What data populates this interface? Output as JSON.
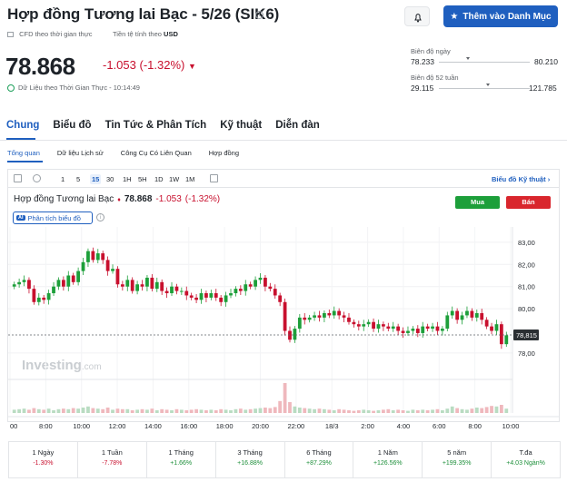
{
  "header": {
    "title": "Hợp đồng Tương lai Bạc - 5/26 (SIK6)",
    "watchlist_label": "Thêm vào Danh Mục",
    "cfd_label": "CFD theo thời gian thực",
    "currency_label": "Tiền tệ tính theo",
    "currency": "USD"
  },
  "quote": {
    "price": "78.868",
    "change": "-1.053",
    "change_pct": "(-1.32%)",
    "realtime_label": "Dữ Liệu theo Thời Gian Thực - 10:14:49"
  },
  "ranges": {
    "day_label": "Biên độ ngày",
    "day_low": "78.233",
    "day_high": "80.210",
    "day_fraction": 0.32,
    "week52_label": "Biên độ 52 tuần",
    "week52_low": "29.115",
    "week52_high": "121.785",
    "week52_fraction": 0.54
  },
  "tabs": [
    "Chung",
    "Biểu đồ",
    "Tin Tức & Phân Tích",
    "Kỹ thuật",
    "Diễn đàn"
  ],
  "subtabs": [
    "Tổng quan",
    "Dữ liệu Lịch sử",
    "Công Cụ Có Liên Quan",
    "Hợp đồng"
  ],
  "toolbar": {
    "timeframes": [
      "1",
      "5",
      "15",
      "30",
      "1H",
      "5H",
      "1D",
      "1W",
      "1M"
    ],
    "active_timeframe": "15",
    "tech_link": "Biểu đồ Kỹ thuật"
  },
  "chart_header": {
    "name": "Hợp đồng Tương lai Bạc",
    "price": "78.868",
    "change": "-1.053",
    "change_pct": "(-1.32%)",
    "buy_label": "Mua",
    "sell_label": "Bán",
    "analyze_label": "Phân tích biểu đồ",
    "ai_label": "AI",
    "watermark": "Investing",
    "watermark_suffix": ".com",
    "last_price_tag": "78,815"
  },
  "chart_data": {
    "type": "candlestick",
    "interval": "15",
    "x_ticks": [
      "00",
      "8:00",
      "10:00",
      "12:00",
      "14:00",
      "16:00",
      "18:00",
      "20:00",
      "22:00",
      "18/3",
      "2:00",
      "4:00",
      "6:00",
      "8:00",
      "10:00"
    ],
    "y_ticks": [
      "83,00",
      "82,00",
      "81,00",
      "80,00",
      "78,00"
    ],
    "ylim": [
      77.3,
      83.2
    ],
    "last_price": 78.815,
    "closes": [
      81.1,
      81.2,
      81.3,
      80.9,
      80.3,
      80.5,
      80.4,
      80.7,
      81.0,
      81.3,
      81.0,
      81.5,
      81.2,
      81.7,
      82.1,
      82.6,
      82.2,
      82.5,
      82.2,
      81.7,
      81.8,
      81.1,
      81.0,
      81.3,
      80.8,
      81.1,
      81.0,
      81.4,
      80.9,
      81.2,
      80.8,
      80.7,
      81.0,
      80.8,
      80.8,
      80.6,
      80.5,
      80.4,
      80.7,
      80.5,
      80.7,
      80.5,
      80.3,
      80.6,
      80.7,
      80.9,
      80.8,
      81.1,
      81.0,
      81.3,
      81.4,
      81.0,
      80.9,
      80.6,
      80.3,
      79.0,
      78.6,
      79.1,
      79.6,
      79.5,
      79.6,
      79.7,
      79.6,
      79.8,
      79.7,
      79.9,
      79.7,
      79.6,
      79.4,
      79.3,
      79.2,
      79.3,
      79.4,
      79.1,
      79.3,
      79.2,
      79.1,
      79.2,
      79.0,
      78.9,
      79.0,
      79.1,
      78.9,
      79.2,
      79.1,
      79.2,
      79.0,
      79.1,
      79.7,
      79.9,
      79.5,
      79.7,
      79.9,
      79.6,
      79.8,
      79.5,
      79.2,
      79.0,
      79.3,
      78.4,
      78.8
    ],
    "volumes": [
      6,
      7,
      8,
      6,
      9,
      7,
      6,
      8,
      5,
      7,
      8,
      7,
      9,
      8,
      10,
      12,
      9,
      8,
      7,
      10,
      6,
      8,
      7,
      7,
      5,
      6,
      7,
      6,
      8,
      5,
      7,
      6,
      5,
      7,
      6,
      5,
      6,
      7,
      6,
      5,
      6,
      5,
      7,
      6,
      5,
      7,
      8,
      6,
      7,
      8,
      9,
      10,
      9,
      11,
      22,
      55,
      20,
      12,
      10,
      9,
      8,
      7,
      8,
      7,
      6,
      5,
      7,
      6,
      5,
      4,
      5,
      6,
      5,
      4,
      5,
      6,
      7,
      5,
      6,
      5,
      4,
      6,
      5,
      6,
      5,
      6,
      7,
      5,
      8,
      12,
      9,
      7,
      6,
      8,
      10,
      9,
      11,
      13,
      12,
      15,
      8
    ]
  },
  "performance": [
    {
      "label": "1 Ngày",
      "value": "-1.30%",
      "trend": "neg"
    },
    {
      "label": "1 Tuần",
      "value": "-7.78%",
      "trend": "neg"
    },
    {
      "label": "1 Tháng",
      "value": "+1.66%",
      "trend": "pos"
    },
    {
      "label": "3 Tháng",
      "value": "+16.88%",
      "trend": "pos"
    },
    {
      "label": "6 Tháng",
      "value": "+87.29%",
      "trend": "pos"
    },
    {
      "label": "1 Năm",
      "value": "+126.56%",
      "trend": "pos"
    },
    {
      "label": "5 năm",
      "value": "+199.35%",
      "trend": "pos"
    },
    {
      "label": "T.đa",
      "value": "+4.03 Ngàn%",
      "trend": "pos"
    }
  ],
  "colors": {
    "up": "#1d9f3a",
    "down": "#c8102e",
    "accent": "#1f5fbf"
  }
}
